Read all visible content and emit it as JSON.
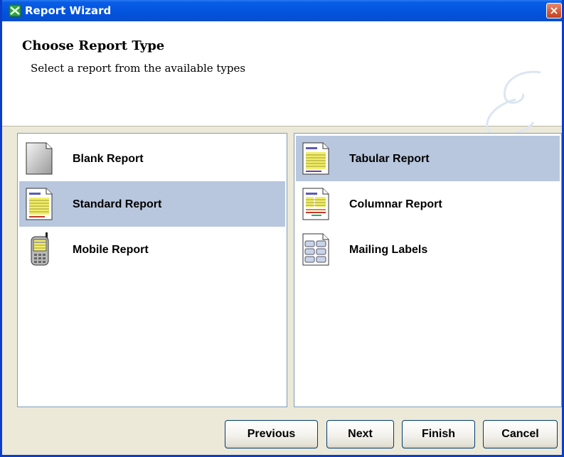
{
  "window": {
    "title": "Report Wizard",
    "close_label": "×"
  },
  "header": {
    "title": "Choose Report Type",
    "subtitle": "Select a report from the available types"
  },
  "left_list": [
    {
      "label": "Blank Report",
      "icon": "blank-report-icon",
      "selected": false
    },
    {
      "label": "Standard Report",
      "icon": "standard-report-icon",
      "selected": true
    },
    {
      "label": "Mobile Report",
      "icon": "mobile-report-icon",
      "selected": false
    }
  ],
  "right_list": [
    {
      "label": "Tabular Report",
      "icon": "tabular-report-icon",
      "selected": true
    },
    {
      "label": "Columnar Report",
      "icon": "columnar-report-icon",
      "selected": false
    },
    {
      "label": "Mailing Labels",
      "icon": "mailing-labels-icon",
      "selected": false
    }
  ],
  "buttons": {
    "previous": "Previous",
    "next": "Next",
    "finish": "Finish",
    "cancel": "Cancel"
  },
  "colors": {
    "titlebar": "#0556e0",
    "selection": "#b8c7de",
    "dialog_bg": "#ece9d8"
  }
}
